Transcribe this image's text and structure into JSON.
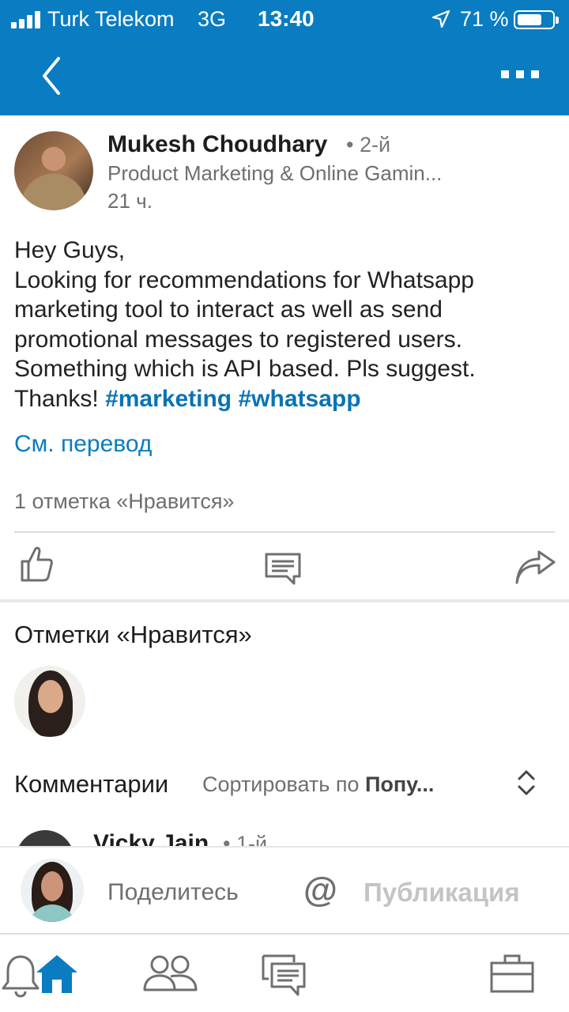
{
  "status_bar": {
    "carrier": "Turk Telekom",
    "network": "3G",
    "time": "13:40",
    "battery_percent": "71 %",
    "battery_level": 0.71,
    "icons": [
      "signal-icon",
      "location-arrow-icon",
      "battery-icon"
    ]
  },
  "nav": {
    "back_icon": "chevron-left-icon",
    "more_icon": "more-dots-icon"
  },
  "post": {
    "author": {
      "name": "Mukesh Choudhary",
      "degree": "• 2-й",
      "headline": "Product Marketing & Online Gamin...",
      "time": "21 ч."
    },
    "body_lines": [
      "Hey Guys,",
      "Looking for recommendations for Whatsapp",
      "marketing tool to interact as well as send",
      "promotional messages to registered users.",
      "Something which is API based. Pls suggest.",
      "Thanks! "
    ],
    "hashtags": [
      "#marketing",
      "#whatsapp"
    ],
    "see_translation": "См. перевод",
    "likes_count": "1 отметка «Нравится»",
    "actions": [
      "like-icon",
      "comment-icon",
      "share-icon"
    ]
  },
  "likes_section": {
    "title": "Отметки «Нравится»"
  },
  "comments_section": {
    "title": "Комментарии",
    "sort_prefix": "Сортировать по ",
    "sort_value": "Попу...",
    "first_comment": {
      "name": "Vicky Jain",
      "degree": "• 1-й"
    }
  },
  "composer": {
    "placeholder": "Поделитесь",
    "mention_symbol": "@",
    "publish_label": "Публикация"
  },
  "tabbar": {
    "items": [
      "home-icon",
      "network-icon",
      "messages-icon",
      "notifications-icon",
      "jobs-icon"
    ],
    "active": "home-icon"
  },
  "colors": {
    "brand_blue": "#0a7cc1",
    "hashtag_blue": "#0a73b4",
    "muted_text": "#6f6f6f",
    "icon_gray": "#6f6f6f"
  }
}
